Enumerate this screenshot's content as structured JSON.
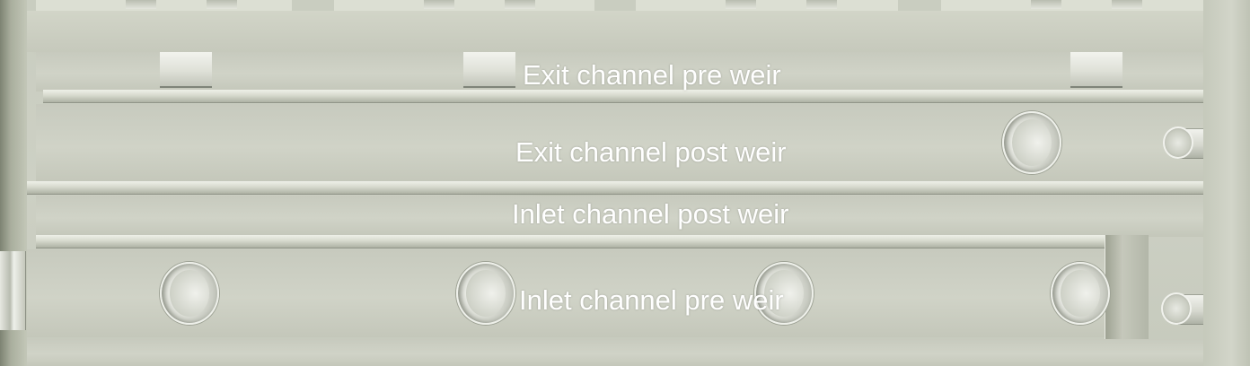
{
  "labels": {
    "exit_pre_weir": "Exit channel pre weir",
    "exit_post_weir": "Exit channel post weir",
    "inlet_post_weir": "Inlet channel post weir",
    "inlet_pre_weir": "Inlet channel pre weir"
  },
  "colors": {
    "concrete": "#c9cdc0",
    "label_text": "#ffffff"
  }
}
